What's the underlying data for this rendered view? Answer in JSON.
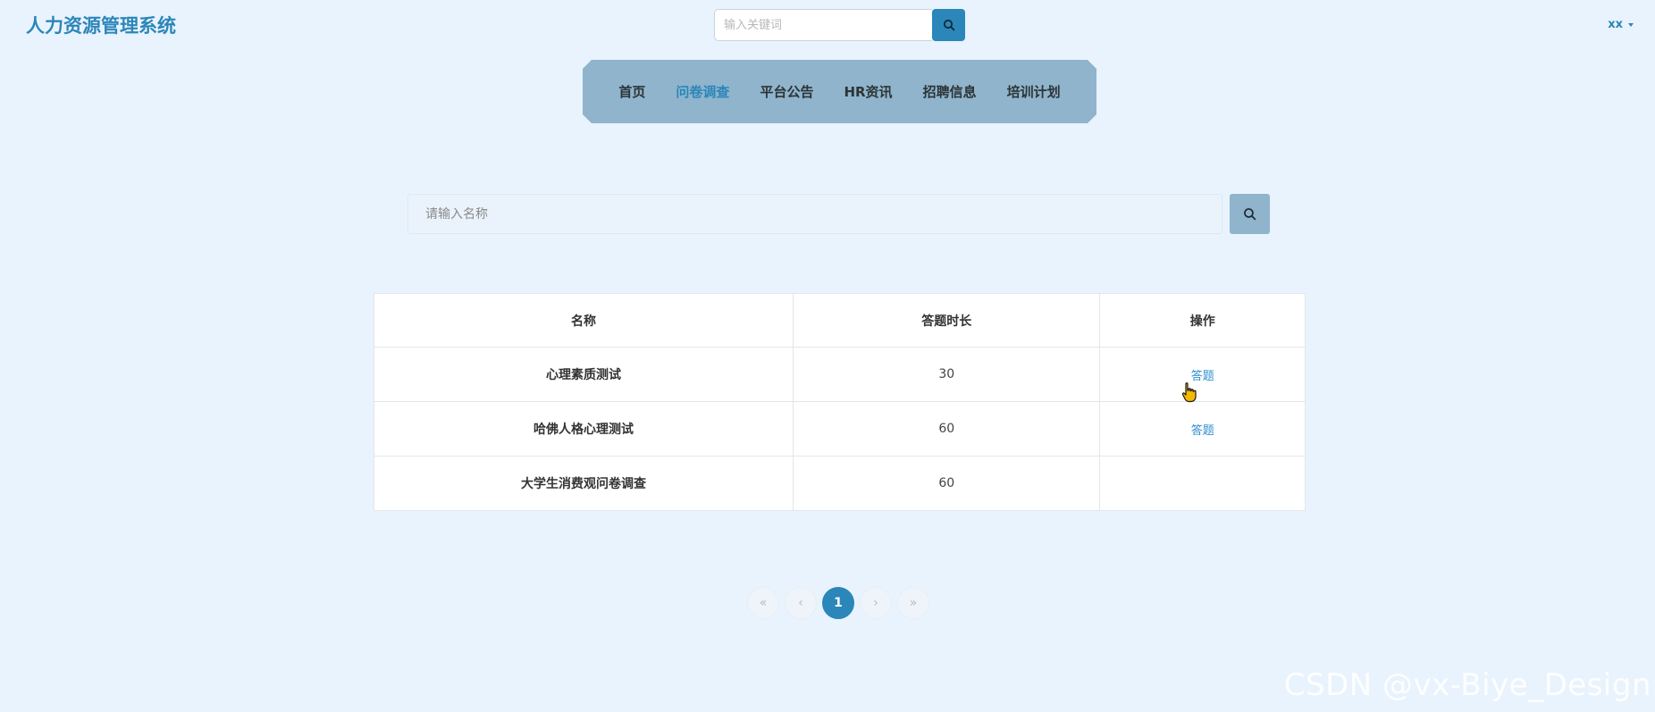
{
  "header": {
    "title": "人力资源管理系统",
    "search_placeholder": "输入关键词",
    "search_icon": "search-icon",
    "user_name": "xx"
  },
  "nav": {
    "items": [
      {
        "label": "首页",
        "active": false
      },
      {
        "label": "问卷调查",
        "active": true
      },
      {
        "label": "平台公告",
        "active": false
      },
      {
        "label": "HR资讯",
        "active": false
      },
      {
        "label": "招聘信息",
        "active": false
      },
      {
        "label": "培训计划",
        "active": false
      }
    ]
  },
  "filter": {
    "placeholder": "请输入名称",
    "search_icon": "search-icon"
  },
  "table": {
    "headers": [
      "名称",
      "答题时长",
      "操作"
    ],
    "rows": [
      {
        "name": "心理素质测试",
        "duration": "30",
        "action": "答题"
      },
      {
        "name": "哈佛人格心理测试",
        "duration": "60",
        "action": "答题"
      },
      {
        "name": "大学生消费观问卷调查",
        "duration": "60",
        "action": ""
      }
    ]
  },
  "pagination": {
    "first": "«",
    "prev": "‹",
    "current": "1",
    "next": "›",
    "last": "»"
  },
  "watermark": "CSDN @vx-Biye_Design",
  "colors": {
    "brand": "#2b86b9",
    "background": "#e9f3fd",
    "nav_bar": "#8fb4cc",
    "link": "#2f8fd0"
  }
}
